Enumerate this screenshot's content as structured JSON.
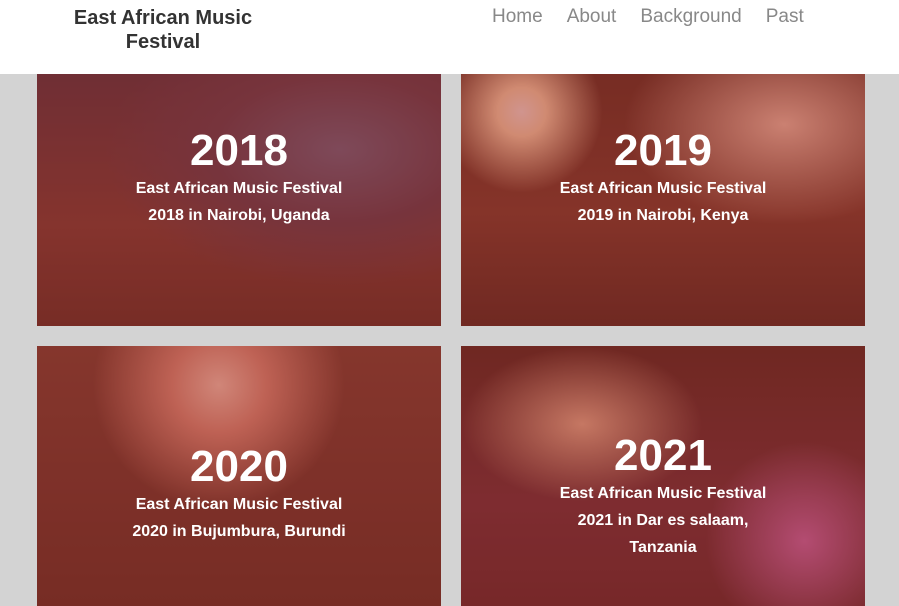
{
  "header": {
    "brand": "East African Music Festival",
    "nav": [
      "Home",
      "About",
      "Background",
      "Past"
    ]
  },
  "cards": [
    {
      "year": "2018",
      "line1": "East African Music Festival",
      "line2": "2018 in Nairobi, Uganda"
    },
    {
      "year": "2019",
      "line1": "East African Music Festival",
      "line2": "2019 in Nairobi, Kenya"
    },
    {
      "year": "2020",
      "line1": "East African Music Festival",
      "line2": "2020 in Bujumbura, Burundi"
    },
    {
      "year": "2021",
      "line1": "East African Music Festival",
      "line2": "2021 in Dar es salaam, Tanzania"
    }
  ],
  "colors": {
    "overlay": "#aa3c32",
    "page_bg": "#d3d3d3",
    "nav_text": "#888888"
  }
}
